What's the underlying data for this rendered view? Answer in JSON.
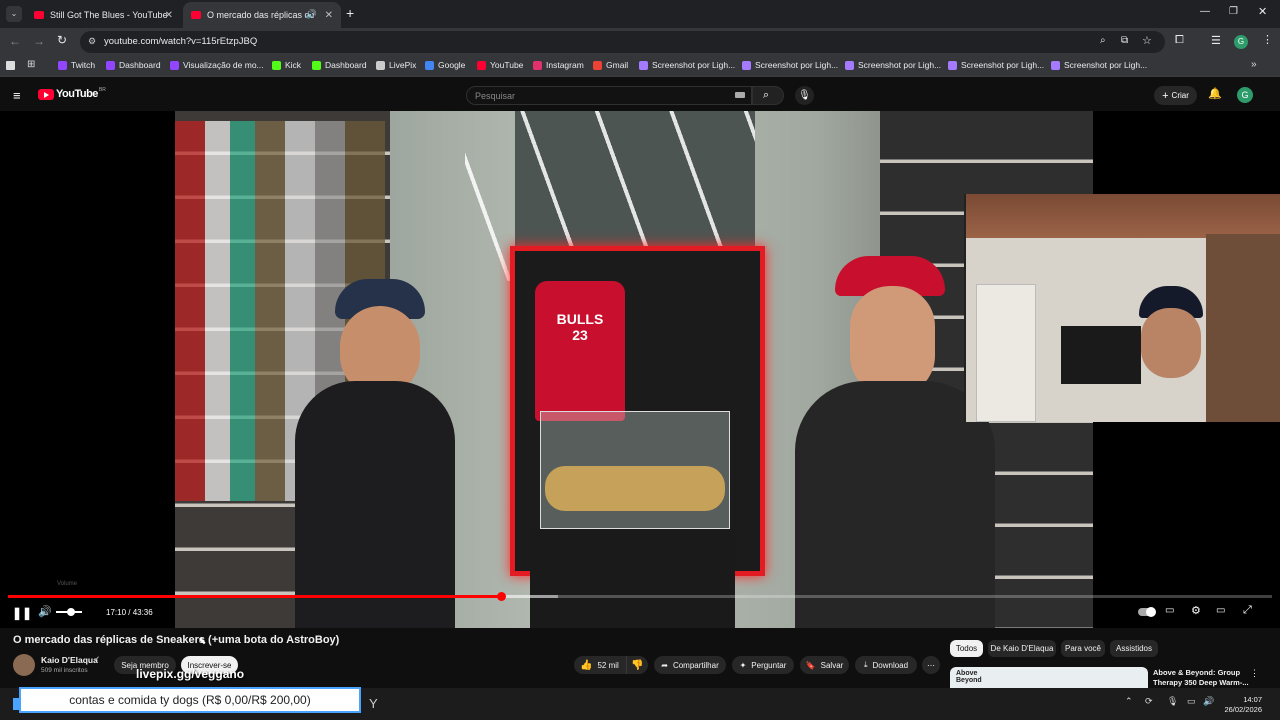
{
  "browser": {
    "tabs": [
      {
        "label": "Still Got The Blues - YouTube"
      },
      {
        "label": "O mercado das réplicas de"
      }
    ],
    "url": "youtube.com/watch?v=115rEtzpJBQ",
    "bookmarks": [
      {
        "label": "Twitch",
        "color": "#9146ff"
      },
      {
        "label": "Dashboard",
        "color": "#9146ff"
      },
      {
        "label": "Visualização de mo...",
        "color": "#9146ff"
      },
      {
        "label": "Kick",
        "color": "#53fc18"
      },
      {
        "label": "Dashboard",
        "color": "#53fc18"
      },
      {
        "label": "LivePix",
        "color": "#cccccc"
      },
      {
        "label": "Google",
        "color": "#4285f4"
      },
      {
        "label": "YouTube",
        "color": "#ff0033"
      },
      {
        "label": "Instagram",
        "color": "#e1306c"
      },
      {
        "label": "Gmail",
        "color": "#ea4335"
      },
      {
        "label": "Screenshot por Ligh...",
        "color": "#a47bff"
      },
      {
        "label": "Screenshot por Ligh...",
        "color": "#a47bff"
      },
      {
        "label": "Screenshot por Ligh...",
        "color": "#a47bff"
      },
      {
        "label": "Screenshot por Ligh...",
        "color": "#a47bff"
      },
      {
        "label": "Screenshot por Ligh...",
        "color": "#a47bff"
      }
    ]
  },
  "youtube": {
    "logo": "YouTube",
    "logo_region": "BR",
    "search_placeholder": "Pesquisar",
    "create_label": "Criar",
    "avatar_letter": "G"
  },
  "player": {
    "volume_tooltip": "Volume",
    "time": "17:10 / 43:36",
    "progress_fraction": 0.39,
    "buffered_fraction": 0.435
  },
  "video": {
    "title": "O mercado das réplicas de Sneakers (+uma bota do AstroBoy)",
    "channel": "Kaio D'Elaqua",
    "subscribers": "509 mil inscritos",
    "join_label": "Seja membro",
    "subscribe_label": "Inscrever-se",
    "likes": "52 mil",
    "share_label": "Compartilhar",
    "ask_label": "Perguntar",
    "save_label": "Salvar",
    "download_label": "Download"
  },
  "sidebar": {
    "chips": [
      "Todos",
      "De Kaio D'Elaqua",
      "Para você",
      "Assistidos"
    ],
    "next_video_title": "Above & Beyond: Group Therapy 350 Deep Warm-...",
    "next_thumb_text": "Above Beyond"
  },
  "stream_overlay": {
    "livepix_text": "livepix.gg/veggano",
    "goal_text": "contas e comida ty dogs (R$ 0,00/R$ 200,00)"
  },
  "taskbar": {
    "time": "14:07",
    "date": "26/02/2026"
  }
}
